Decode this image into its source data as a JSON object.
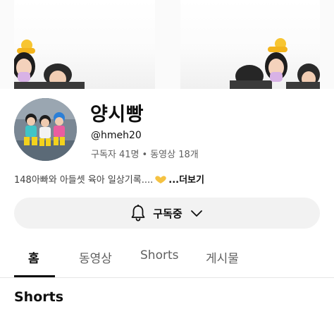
{
  "banner": {
    "icon": "banner-art"
  },
  "channel": {
    "name": "양시빵",
    "handle": "@hmeh20",
    "subscribers": "구독자 41명",
    "separator": "•",
    "videos": "동영상 18개",
    "description": "148아빠와 아들셋 육아 일상기록....",
    "more_label": "...더보기"
  },
  "subscribe": {
    "label": "구독중",
    "bell_icon": "bell-icon",
    "chevron_icon": "chevron-down-icon"
  },
  "tabs": [
    {
      "label": "홈"
    },
    {
      "label": "동영상"
    },
    {
      "label": "Shorts"
    },
    {
      "label": "게시물"
    }
  ],
  "section": {
    "title": "Shorts"
  },
  "colors": {
    "button_bg": "#f2f2f2",
    "secondary_text": "#606060",
    "heart": "#f5c242"
  }
}
